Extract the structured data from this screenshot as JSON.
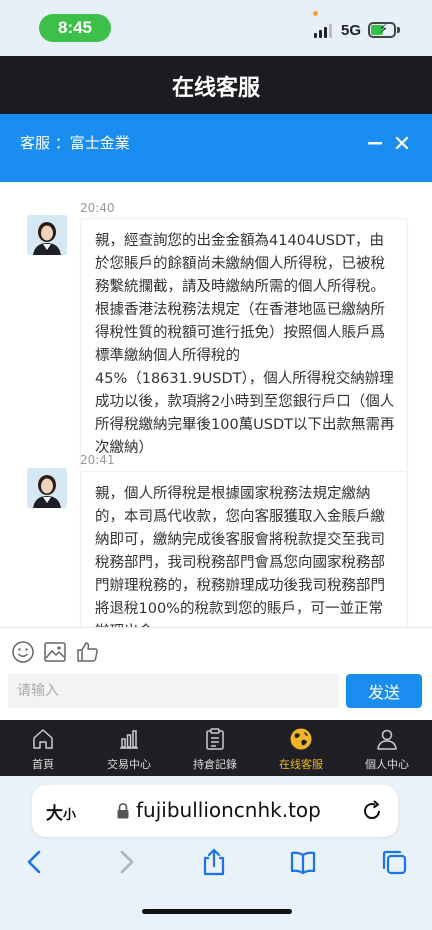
{
  "status_bar": {
    "time": "8:45",
    "network": "5G"
  },
  "app_header": {
    "title": "在线客服"
  },
  "chat_header": {
    "title": "客服 ：富士金業",
    "minimize": "−",
    "close": "✕"
  },
  "messages": [
    {
      "time": "20:40",
      "text": "親，經查詢您的出金金額為41404USDT，由於您賬戶的餘額尚未繳納個人所得稅，已被稅務繫統攔截，請及時繳納所需的個人所得稅。根據香港法稅務法規定（在香港地區已繳納所得稅性質的稅額可進行抵免）按照個人賬戶爲標準繳納個人所得稅的45%（18631.9USDT），個人所得稅交納辦理成功以後，款項將2小時到至您銀行戶口（個人所得稅繳納完畢後100萬USDT以下出款無需再次繳納）"
    },
    {
      "time": "20:41",
      "text": "親，個人所得稅是根據國家稅務法規定繳納的，本司爲代收款，您向客服獲取入金賬戶繳納即可，繳納完成後客服會將稅款提交至我司稅務部門，我司稅務部門會爲您向國家稅務部門辦理稅務的，稅務辦理成功後我司稅務部門將退稅100%的稅款到您的賬戶，可一並正常辦理出金。"
    }
  ],
  "input": {
    "placeholder": "请输入",
    "value": ""
  },
  "send_label": "发送",
  "tabs": [
    {
      "label": "首頁",
      "icon": "home-icon",
      "active": false
    },
    {
      "label": "交易中心",
      "icon": "bar-chart-icon",
      "active": false
    },
    {
      "label": "持倉記錄",
      "icon": "clipboard-icon",
      "active": false
    },
    {
      "label": "在线客服",
      "icon": "globe-icon",
      "active": true
    },
    {
      "label": "個人中心",
      "icon": "person-icon",
      "active": false
    }
  ],
  "browser": {
    "text_size_label": "大",
    "text_size_small": "小",
    "url": "fujibullioncnhk.top"
  },
  "colors": {
    "accent": "#1a8df0",
    "active_tab": "#f0b429",
    "dark_bar": "#1b1c20"
  }
}
